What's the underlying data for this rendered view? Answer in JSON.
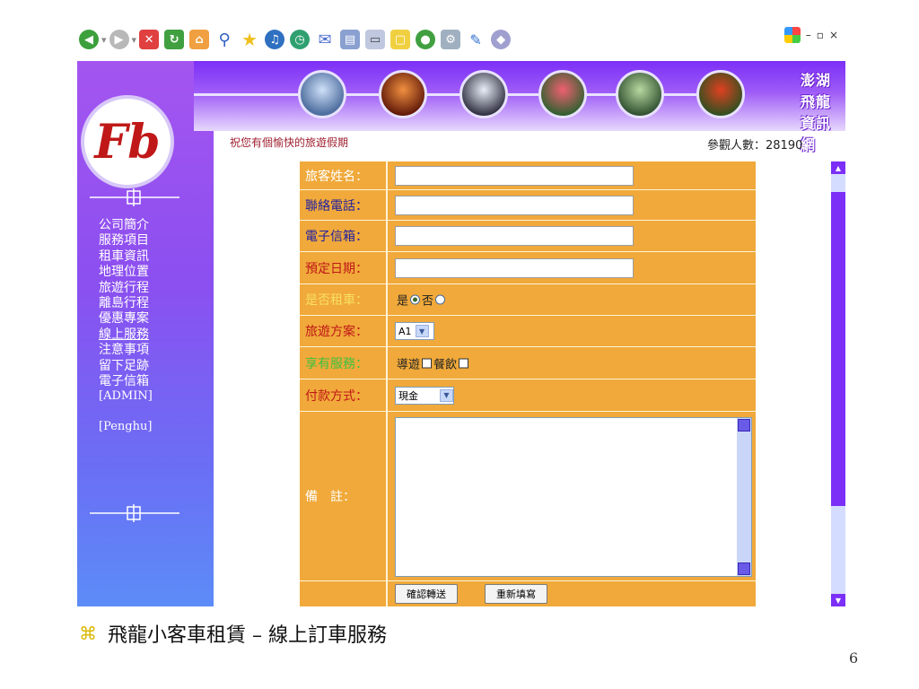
{
  "browser": {
    "toolbar_icons": [
      "back-icon",
      "forward-icon",
      "stop-icon",
      "refresh-icon",
      "home-icon",
      "search-icon",
      "favorites-icon",
      "media-icon",
      "history-icon",
      "mail-icon",
      "print-icon",
      "edit-icon",
      "discuss-icon",
      "messenger-icon",
      "research-icon",
      "bluetooth-icon",
      "chat-icon"
    ],
    "window_controls": [
      "–",
      "▫",
      "×"
    ]
  },
  "site": {
    "title": "澎湖飛龍資訊網",
    "visitor_label": "參觀人數：",
    "visitor_count": "28190",
    "greeting": "祝您有個愉快的旅遊假期",
    "logo_text": "Fb"
  },
  "nav": {
    "items": [
      "公司簡介",
      "服務項目",
      "租車資訊",
      "地理位置",
      "旅遊行程",
      "離島行程",
      "優惠專案",
      "線上服務",
      "注意事項",
      "留下足跡",
      "電子信箱"
    ],
    "active_index": 7,
    "admin": "[ADMIN]",
    "penghu": "[Penghu]"
  },
  "form": {
    "name_label": "旅客姓名：",
    "phone_label": "聯絡電話：",
    "email_label": "電子信箱：",
    "date_label": "預定日期：",
    "rent_label": "是否租車：",
    "rent_yes": "是",
    "rent_no": "否",
    "plan_label": "旅遊方案：",
    "plan_value": "A1",
    "service_label": "享有服務：",
    "service_guide": "導遊",
    "service_meal": "餐飲",
    "payment_label": "付款方式：",
    "payment_value": "現金",
    "remark_label": "備　註：",
    "submit_label": "確認轉送",
    "reset_label": "重新填寫"
  },
  "slide": {
    "bullet": "⌘",
    "caption": "飛龍小客車租賃 – 線上訂車服務",
    "page_number": "6"
  }
}
